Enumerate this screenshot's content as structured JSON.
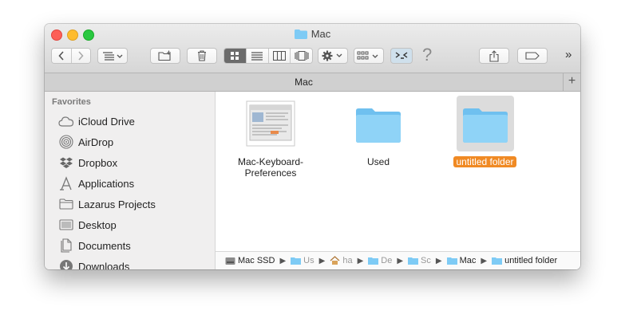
{
  "window": {
    "title": "Mac"
  },
  "toolbar": {
    "overflow": "»",
    "help": "?"
  },
  "tab": {
    "label": "Mac",
    "add": "+"
  },
  "sidebar": {
    "header": "Favorites",
    "items": [
      {
        "label": "iCloud Drive",
        "icon": "cloud-icon"
      },
      {
        "label": "AirDrop",
        "icon": "airdrop-icon"
      },
      {
        "label": "Dropbox",
        "icon": "dropbox-icon"
      },
      {
        "label": "Applications",
        "icon": "applications-icon"
      },
      {
        "label": "Lazarus Projects",
        "icon": "folder-icon"
      },
      {
        "label": "Desktop",
        "icon": "desktop-icon"
      },
      {
        "label": "Documents",
        "icon": "documents-icon"
      },
      {
        "label": "Downloads",
        "icon": "downloads-icon"
      }
    ]
  },
  "files": [
    {
      "line1": "Mac-Keyboard-",
      "line2": "Preferences",
      "icon": "image-file-icon"
    },
    {
      "line1": "Used",
      "line2": "",
      "icon": "folder-icon"
    },
    {
      "line1": "untitled folder",
      "line2": "",
      "icon": "folder-icon",
      "selected": true
    }
  ],
  "pathbar": {
    "items": [
      "Mac SSD",
      "Us",
      "ha",
      "De",
      "Sc",
      "Mac",
      "untitled folder"
    ]
  },
  "colors": {
    "folder": "#7ecbf5",
    "selection": "#f08a24"
  }
}
